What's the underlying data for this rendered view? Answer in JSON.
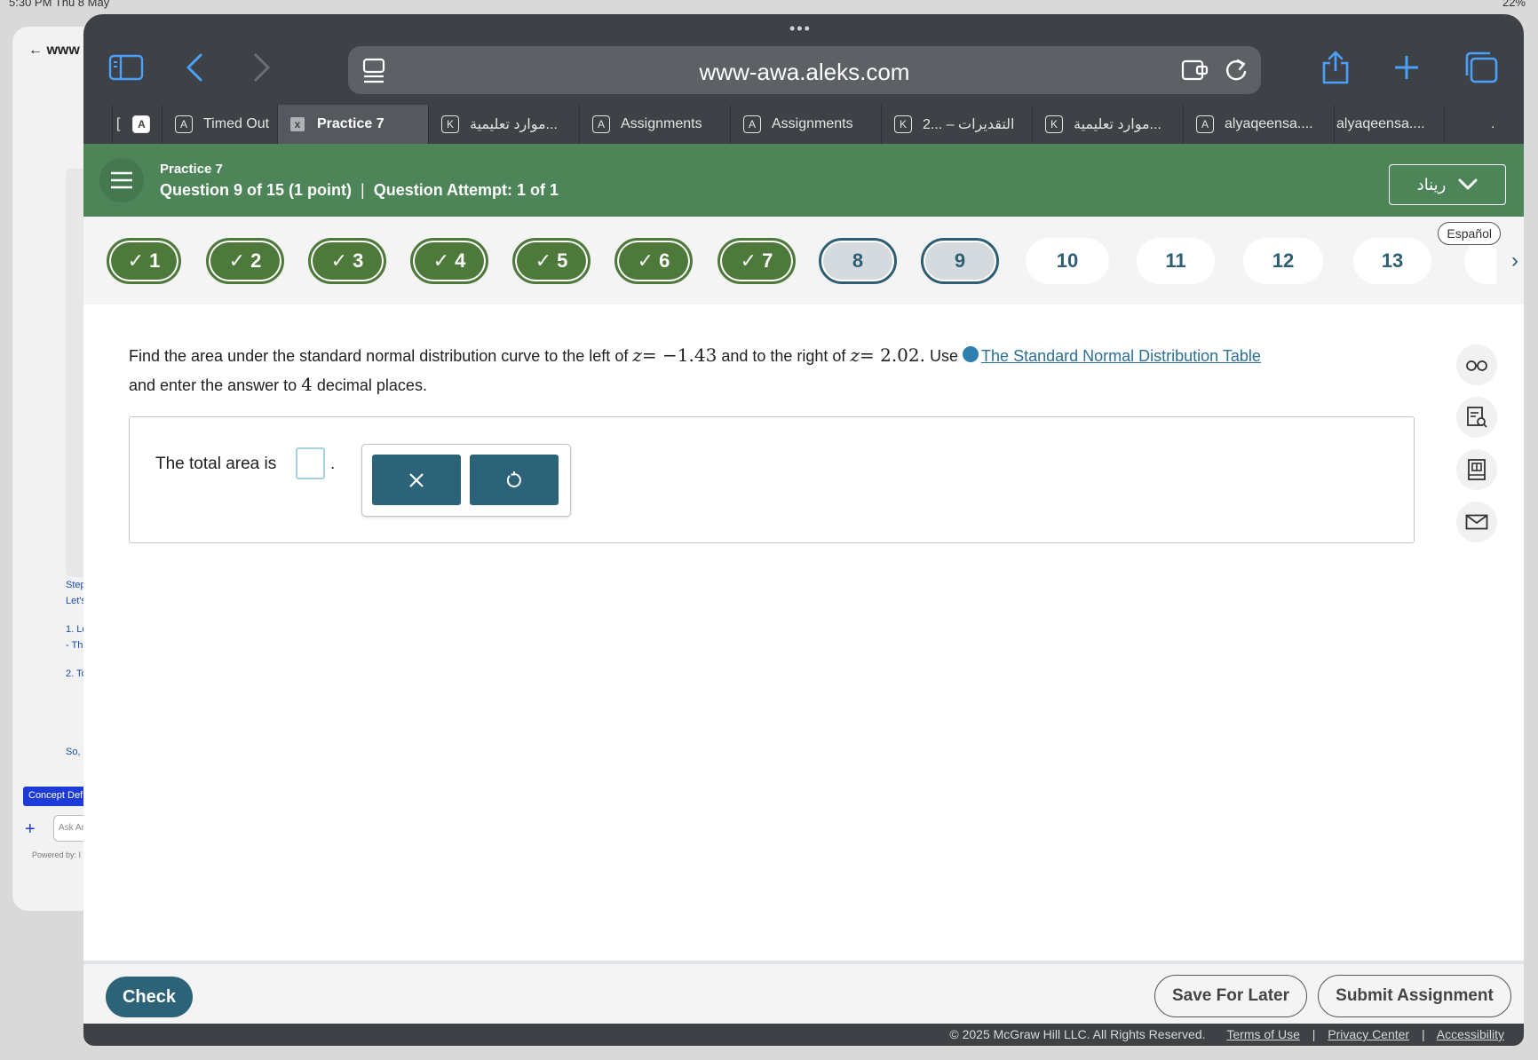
{
  "status_bar": {
    "time": "5:30 PM  Thu 8 May",
    "battery": "22%"
  },
  "background_app": {
    "url_prefix": "www",
    "steps_lines": [
      "Step",
      "Let's",
      "1. Lo",
      "- Th",
      "2. To",
      "So, t"
    ],
    "concept_button": "Concept Def",
    "ask_placeholder": "Ask Ar",
    "powered_by": "Powered by: I"
  },
  "browser": {
    "url": "www-awa.aleks.com",
    "tabs": [
      {
        "favicon": "A",
        "label": "Timed Out"
      },
      {
        "favicon": "x",
        "label": "Practice 7"
      },
      {
        "favicon": "K",
        "label": "موارد تعليمية..."
      },
      {
        "favicon": "A",
        "label": "Assignments"
      },
      {
        "favicon": "A",
        "label": "Assignments"
      },
      {
        "favicon": "K",
        "label": "التقديرات – ...2"
      },
      {
        "favicon": "K",
        "label": "موارد تعليمية..."
      },
      {
        "favicon": "A",
        "label": "alyaqeensa...."
      },
      {
        "favicon": "",
        "label": "alyaqeensa...."
      }
    ]
  },
  "header": {
    "title": "Practice 7",
    "question_info": "Question 9 of 15 (1 point)",
    "attempt_info": "Question Attempt: 1 of 1",
    "language_label": "ريناد"
  },
  "question_nav": {
    "espanol": "Español",
    "items": [
      {
        "label": "✓ 1",
        "state": "done"
      },
      {
        "label": "✓ 2",
        "state": "done"
      },
      {
        "label": "✓ 3",
        "state": "done"
      },
      {
        "label": "✓ 4",
        "state": "done"
      },
      {
        "label": "✓ 5",
        "state": "done"
      },
      {
        "label": "✓ 6",
        "state": "done"
      },
      {
        "label": "✓ 7",
        "state": "done"
      },
      {
        "label": "8",
        "state": "seen"
      },
      {
        "label": "9",
        "state": "current"
      },
      {
        "label": "10",
        "state": "todo"
      },
      {
        "label": "11",
        "state": "todo"
      },
      {
        "label": "12",
        "state": "todo"
      },
      {
        "label": "13",
        "state": "todo"
      }
    ]
  },
  "question": {
    "p1": "Find the area under the standard normal distribution curve to the left of",
    "z1": "z",
    "eq1": "= −1.43",
    "p2": "and to the right of",
    "z2": "z",
    "eq2": "= 2.02.",
    "p3": "Use",
    "table_link": "The Standard Normal Distribution Table",
    "p4": "and enter the answer to",
    "decimals": "4",
    "p5": "decimal places."
  },
  "answer": {
    "label": "The total area is",
    "value": "",
    "suffix": "."
  },
  "footer": {
    "check": "Check",
    "save_for_later": "Save For Later",
    "submit": "Submit Assignment",
    "copyright": "© 2025 McGraw Hill LLC. All Rights Reserved.",
    "terms": "Terms of Use",
    "privacy": "Privacy Center",
    "accessibility": "Accessibility"
  },
  "colors": {
    "header_green": "#4d8559",
    "done_green": "#4d7a3a",
    "teal_button": "#2d6379",
    "link_blue": "#2a6f96",
    "safari_blue": "#4ba0ff"
  }
}
